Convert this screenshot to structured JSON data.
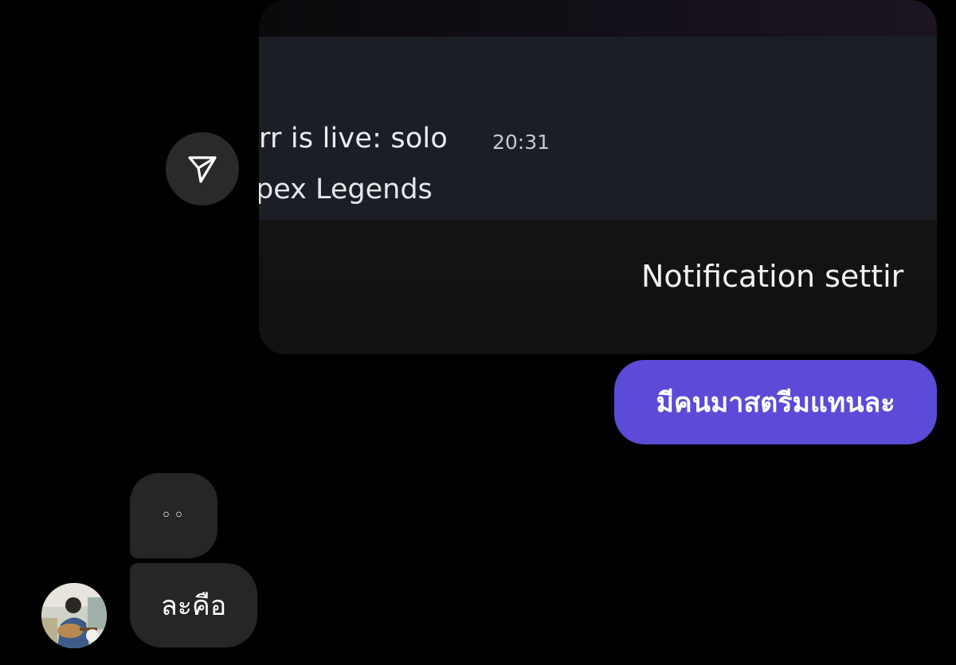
{
  "shared_post": {
    "title": "rr is live: solo",
    "time": "20:31",
    "subtitle": "pex Legends",
    "settings_label": "Notification settir"
  },
  "share_button": {
    "icon": "send-icon"
  },
  "messages": {
    "sent": [
      {
        "text": "มีคนมาสตรีมแทนละ",
        "color": "#5b4bd6"
      }
    ],
    "received": [
      {
        "text": "◦◦"
      },
      {
        "text": "ละคือ"
      }
    ]
  },
  "avatar": {
    "icon": "user-avatar-photo"
  }
}
